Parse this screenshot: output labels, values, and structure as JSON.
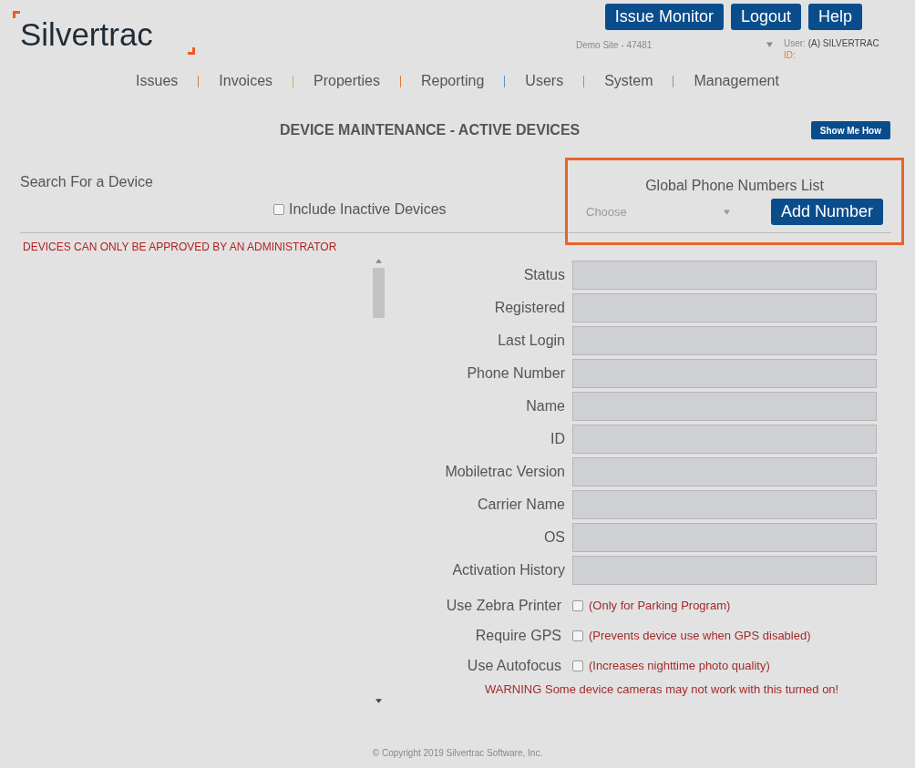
{
  "header": {
    "logo": "Silvertrac",
    "buttons": [
      "Issue Monitor",
      "Logout",
      "Help"
    ],
    "site_select": {
      "value": "Demo Site - 47481"
    },
    "user": {
      "label": "User:",
      "name": "(A) SILVERTRAC",
      "id_label": "ID:"
    }
  },
  "nav": [
    "Issues",
    "Invoices",
    "Properties",
    "Reporting",
    "Users",
    "System",
    "Management"
  ],
  "page": {
    "title": "DEVICE MAINTENANCE - ACTIVE DEVICES",
    "help_button": "Show Me How",
    "search_label": "Search For a Device",
    "include_inactive": {
      "label": "Include Inactive Devices",
      "checked": false
    },
    "global_phone": {
      "title": "Global Phone Numbers List",
      "select": {
        "placeholder": "Choose"
      },
      "button": "Add Number"
    },
    "notice": "DEVICES CAN ONLY BE APPROVED BY AN ADMINISTRATOR",
    "fields": [
      "Status",
      "Registered",
      "Last Login",
      "Phone Number",
      "Name",
      "ID",
      "Mobiletrac Version",
      "Carrier Name",
      "OS",
      "Activation History"
    ],
    "options": [
      {
        "label": "Use Zebra Printer",
        "checked": false,
        "note": "(Only for Parking Program)"
      },
      {
        "label": "Require GPS",
        "checked": false,
        "note": "(Prevents device use when GPS disabled)"
      },
      {
        "label": "Use Autofocus",
        "checked": false,
        "note": "(Increases nighttime photo quality)"
      }
    ],
    "warning": "WARNING Some device cameras may not work with this turned on!"
  },
  "footer": "© Copyright 2019 Silvertrac Software, Inc."
}
